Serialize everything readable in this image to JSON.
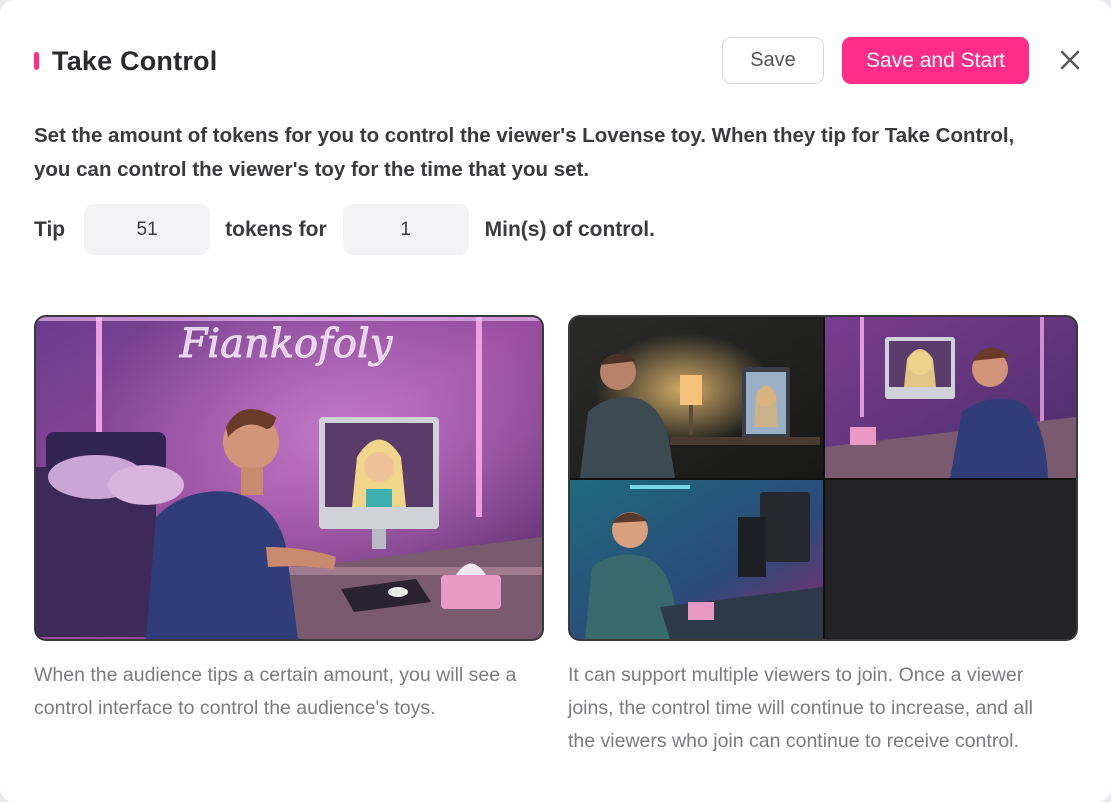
{
  "dialog": {
    "title": "Take Control",
    "save_label": "Save",
    "save_start_label": "Save and Start",
    "accent_color": "#ff2d87"
  },
  "description_line1": "Set the amount of tokens for you to control the viewer's Lovense toy. When they tip for Take Control,",
  "description_line2": "you can control the viewer's toy for the time that you set.",
  "tip_row": {
    "tip_label": "Tip",
    "tokens_value": "51",
    "tokens_for_label": "tokens for",
    "minutes_value": "1",
    "minutes_label": "Min(s) of control."
  },
  "cards": [
    {
      "neon_sign": "Fiankofoly",
      "caption_line1": "When the audience tips a certain amount, you will see a",
      "caption_line2": "control interface to control the audience's toys."
    },
    {
      "caption_line1": "It can support multiple viewers to join. Once a viewer",
      "caption_line2": "joins, the control time will continue to increase, and all",
      "caption_line3": "the viewers who join can continue to receive control."
    }
  ]
}
